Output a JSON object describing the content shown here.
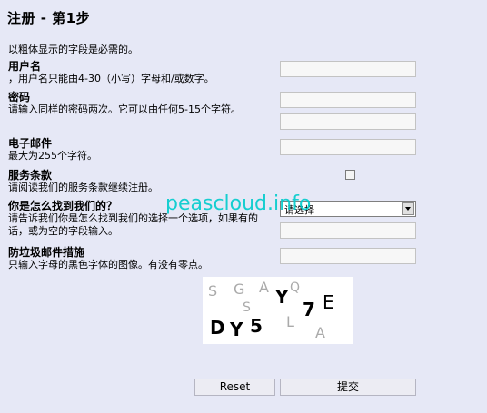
{
  "title": "注册 - 第1步",
  "required_note": "以粗体显示的字段是必需的。",
  "username": {
    "label": "用户名",
    "hint": "，用户名只能由4-30（小写）字母和/或数字。",
    "value": ""
  },
  "password": {
    "label": "密码",
    "hint": "请输入同样的密码两次。它可以由任何5-15个字符。",
    "value": "",
    "confirm_value": ""
  },
  "email": {
    "label": "电子邮件",
    "hint": "最大为255个字符。",
    "value": ""
  },
  "terms": {
    "label": "服务条款",
    "hint": "请阅读我们的服务条款继续注册。",
    "checked": false
  },
  "referral": {
    "label": "你是怎么找到我们的？",
    "hint": "请告诉我们你是怎么找到我们的选择一个选项，如果有的话，或为空的字段输入。",
    "selected": "请选择",
    "other_value": ""
  },
  "antispam": {
    "label": "防垃圾邮件措施",
    "hint": "只输入字母的黑色字体的图像。有没有零点。",
    "value": ""
  },
  "captcha": {
    "letters": [
      {
        "ch": "D",
        "color": "#000"
      },
      {
        "ch": "Y",
        "color": "#000"
      },
      {
        "ch": "5",
        "color": "#000"
      },
      {
        "ch": "Y",
        "color": "#000"
      },
      {
        "ch": "7",
        "color": "#000"
      },
      {
        "ch": "E",
        "color": "#000"
      },
      {
        "ch": "S",
        "color": "#aaa"
      },
      {
        "ch": "G",
        "color": "#aaa"
      },
      {
        "ch": "A",
        "color": "#aaa"
      },
      {
        "ch": "L",
        "color": "#aaa"
      },
      {
        "ch": "S",
        "color": "#aaa"
      },
      {
        "ch": "A",
        "color": "#aaa"
      },
      {
        "ch": "Q",
        "color": "#aaa"
      }
    ]
  },
  "buttons": {
    "reset": "Reset",
    "submit": "提交"
  },
  "watermark": "peascloud.info"
}
